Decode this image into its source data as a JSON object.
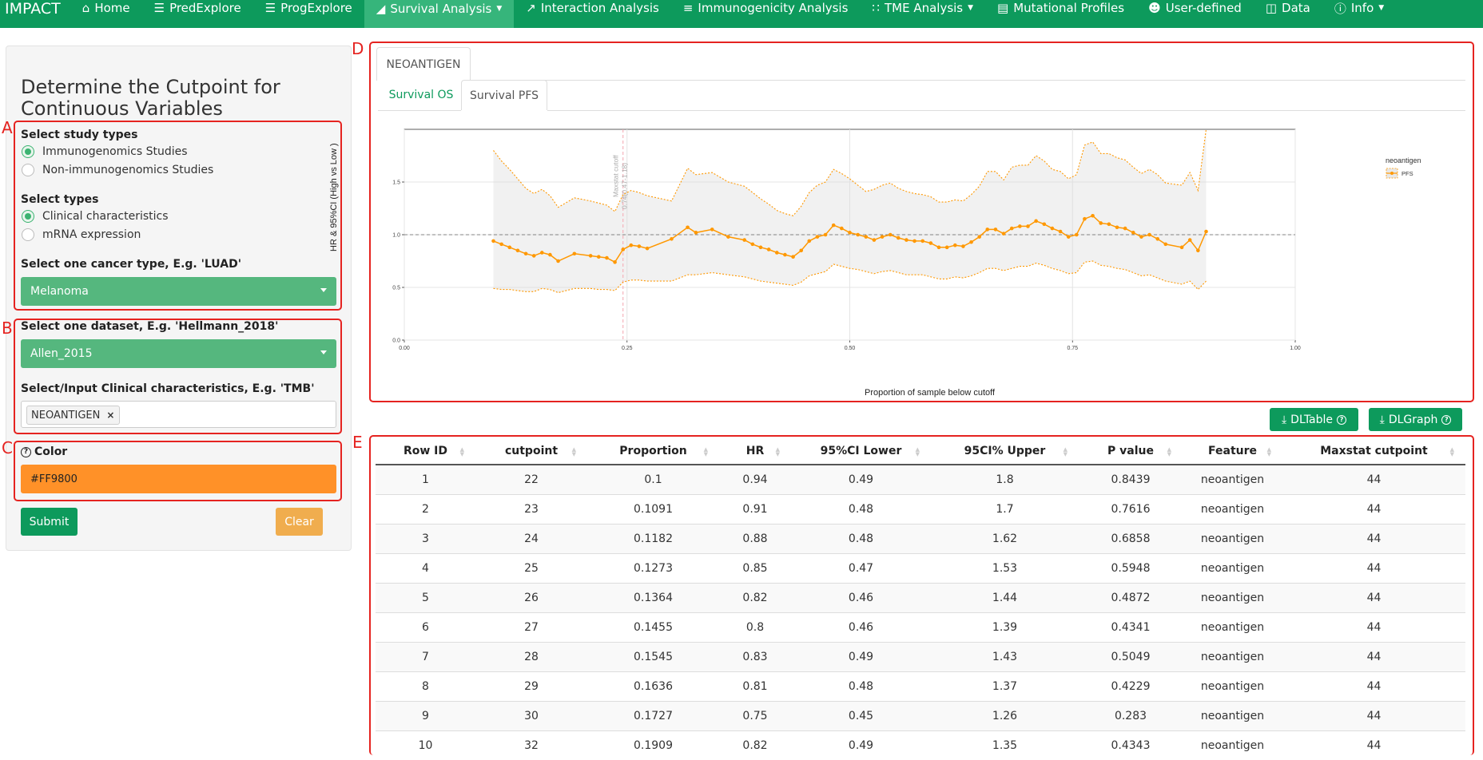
{
  "navbar": {
    "brand": "IMPACT",
    "items": [
      {
        "label": "Home",
        "icon": "home-icon"
      },
      {
        "label": "PredExplore",
        "icon": "list-icon"
      },
      {
        "label": "ProgExplore",
        "icon": "list-icon"
      },
      {
        "label": "Survival Analysis",
        "icon": "area-chart-icon",
        "active": true,
        "dropdown": true
      },
      {
        "label": "Interaction Analysis",
        "icon": "line-chart-icon"
      },
      {
        "label": "Immunogenicity Analysis",
        "icon": "sliders-icon"
      },
      {
        "label": "TME Analysis",
        "icon": "grid-icon",
        "dropdown": true
      },
      {
        "label": "Mutational Profiles",
        "icon": "list-alt-icon"
      },
      {
        "label": "User-defined",
        "icon": "user-icon"
      },
      {
        "label": "Data",
        "icon": "database-icon"
      },
      {
        "label": "Info",
        "icon": "info-icon",
        "dropdown": true
      }
    ]
  },
  "sidebar": {
    "title": "Determine the Cutpoint for Continuous Variables",
    "box_labels": [
      "A",
      "B",
      "C",
      "D",
      "E"
    ],
    "study_types": {
      "label": "Select study types",
      "options": [
        "Immunogenomics Studies",
        "Non-immunogenomics Studies"
      ],
      "selected": "Immunogenomics Studies"
    },
    "types": {
      "label": "Select types",
      "options": [
        "Clinical characteristics",
        "mRNA expression"
      ],
      "selected": "Clinical characteristics"
    },
    "cancer": {
      "label": "Select one cancer type, E.g. 'LUAD'",
      "value": "Melanoma"
    },
    "dataset": {
      "label": "Select one dataset, E.g. 'Hellmann_2018'",
      "value": "Allen_2015"
    },
    "clinical": {
      "label": "Select/Input Clinical characteristics, E.g. 'TMB'",
      "tag": "NEOANTIGEN",
      "tag_remove": "×"
    },
    "color": {
      "label": "Color",
      "value": "#FF9800"
    },
    "submit_label": "Submit",
    "clear_label": "Clear"
  },
  "main": {
    "tab": "NEOANTIGEN",
    "subtabs": [
      {
        "label": "Survival OS",
        "active": false
      },
      {
        "label": "Survival PFS",
        "active": true
      }
    ],
    "dl_table": "DLTable",
    "dl_graph": "DLGraph"
  },
  "chart_data": {
    "type": "line",
    "xlabel": "Proportion of sample below cutoff",
    "ylabel": "HR & 95%CI (High vs Low )",
    "xlim": [
      0,
      1
    ],
    "ylim": [
      0,
      2
    ],
    "xticks": [
      "0.00",
      "0.25",
      "0.50",
      "0.75",
      "1.00"
    ],
    "yticks": [
      "0.0",
      "0.5",
      "1.0",
      "1.5"
    ],
    "reference_line": 1.0,
    "cutoff_x": 0.2455,
    "cutoff_label": "Maxstat cutoff",
    "cutoff_sublabel": "0.74(0.47-1.18)",
    "legend_title": "neoantigen",
    "series": [
      {
        "name": "PFS",
        "color": "#FF9800",
        "x": [
          0.1,
          0.1091,
          0.1182,
          0.1273,
          0.1364,
          0.1455,
          0.1545,
          0.1636,
          0.1727,
          0.1909,
          0.2091,
          0.2182,
          0.2273,
          0.2364,
          0.2455,
          0.2545,
          0.2636,
          0.2727,
          0.3,
          0.318,
          0.3273,
          0.3455,
          0.3636,
          0.3818,
          0.3909,
          0.4,
          0.4091,
          0.4182,
          0.4273,
          0.4364,
          0.4455,
          0.4545,
          0.4636,
          0.4727,
          0.4818,
          0.4909,
          0.5,
          0.5091,
          0.5182,
          0.5273,
          0.5364,
          0.5455,
          0.5545,
          0.5636,
          0.5727,
          0.5818,
          0.5909,
          0.6,
          0.6091,
          0.6182,
          0.6273,
          0.6364,
          0.6455,
          0.6545,
          0.6636,
          0.6727,
          0.6818,
          0.6909,
          0.7,
          0.7091,
          0.7182,
          0.7273,
          0.7364,
          0.7455,
          0.7545,
          0.7636,
          0.7727,
          0.7818,
          0.7909,
          0.8,
          0.8091,
          0.8182,
          0.8273,
          0.8364,
          0.8455,
          0.8545,
          0.8727,
          0.8818,
          0.8909,
          0.9
        ],
        "hr": [
          0.94,
          0.91,
          0.88,
          0.85,
          0.82,
          0.8,
          0.83,
          0.81,
          0.75,
          0.82,
          0.8,
          0.79,
          0.78,
          0.74,
          0.86,
          0.9,
          0.89,
          0.87,
          0.96,
          1.07,
          1.02,
          1.05,
          0.98,
          0.95,
          0.91,
          0.88,
          0.86,
          0.83,
          0.81,
          0.79,
          0.85,
          0.94,
          0.98,
          1.0,
          1.09,
          1.06,
          1.02,
          1.0,
          0.98,
          0.95,
          0.98,
          1.0,
          0.97,
          0.95,
          0.94,
          0.94,
          0.92,
          0.88,
          0.88,
          0.9,
          0.89,
          0.93,
          0.98,
          1.05,
          1.05,
          1.01,
          1.06,
          1.08,
          1.08,
          1.13,
          1.1,
          1.06,
          1.03,
          0.98,
          1.0,
          1.15,
          1.18,
          1.11,
          1.1,
          1.07,
          1.06,
          1.02,
          0.98,
          1.0,
          0.96,
          0.91,
          0.88,
          0.95,
          0.85,
          1.03
        ],
        "lower": [
          0.49,
          0.48,
          0.48,
          0.47,
          0.46,
          0.46,
          0.49,
          0.48,
          0.45,
          0.49,
          0.49,
          0.48,
          0.48,
          0.47,
          0.55,
          0.57,
          0.57,
          0.56,
          0.56,
          0.62,
          0.62,
          0.64,
          0.62,
          0.6,
          0.58,
          0.56,
          0.55,
          0.54,
          0.53,
          0.52,
          0.55,
          0.61,
          0.63,
          0.65,
          0.72,
          0.7,
          0.68,
          0.67,
          0.65,
          0.63,
          0.65,
          0.66,
          0.64,
          0.62,
          0.62,
          0.62,
          0.6,
          0.58,
          0.58,
          0.6,
          0.59,
          0.61,
          0.64,
          0.68,
          0.68,
          0.66,
          0.68,
          0.7,
          0.7,
          0.73,
          0.71,
          0.68,
          0.66,
          0.63,
          0.64,
          0.74,
          0.75,
          0.71,
          0.7,
          0.68,
          0.67,
          0.64,
          0.61,
          0.62,
          0.59,
          0.56,
          0.53,
          0.56,
          0.48,
          0.56
        ],
        "upper": [
          1.8,
          1.7,
          1.62,
          1.53,
          1.44,
          1.39,
          1.43,
          1.37,
          1.26,
          1.35,
          1.32,
          1.3,
          1.28,
          1.22,
          1.38,
          1.42,
          1.4,
          1.37,
          1.32,
          1.63,
          1.57,
          1.59,
          1.5,
          1.46,
          1.4,
          1.34,
          1.29,
          1.23,
          1.2,
          1.18,
          1.27,
          1.4,
          1.47,
          1.5,
          1.62,
          1.58,
          1.53,
          1.47,
          1.41,
          1.43,
          1.47,
          1.49,
          1.44,
          1.41,
          1.39,
          1.38,
          1.36,
          1.31,
          1.31,
          1.33,
          1.32,
          1.38,
          1.46,
          1.6,
          1.6,
          1.52,
          1.64,
          1.66,
          1.66,
          1.75,
          1.7,
          1.62,
          1.6,
          1.53,
          1.57,
          1.85,
          1.88,
          1.77,
          1.77,
          1.73,
          1.71,
          1.64,
          1.58,
          1.62,
          1.57,
          1.49,
          1.47,
          1.59,
          1.42,
          2.0
        ]
      }
    ]
  },
  "table": {
    "columns": [
      "Row ID",
      "cutpoint",
      "Proportion",
      "HR",
      "95%CI Lower",
      "95CI% Upper",
      "P value",
      "Feature",
      "Maxstat cutpoint"
    ],
    "rows": [
      [
        "1",
        "22",
        "0.1",
        "0.94",
        "0.49",
        "1.8",
        "0.8439",
        "neoantigen",
        "44"
      ],
      [
        "2",
        "23",
        "0.1091",
        "0.91",
        "0.48",
        "1.7",
        "0.7616",
        "neoantigen",
        "44"
      ],
      [
        "3",
        "24",
        "0.1182",
        "0.88",
        "0.48",
        "1.62",
        "0.6858",
        "neoantigen",
        "44"
      ],
      [
        "4",
        "25",
        "0.1273",
        "0.85",
        "0.47",
        "1.53",
        "0.5948",
        "neoantigen",
        "44"
      ],
      [
        "5",
        "26",
        "0.1364",
        "0.82",
        "0.46",
        "1.44",
        "0.4872",
        "neoantigen",
        "44"
      ],
      [
        "6",
        "27",
        "0.1455",
        "0.8",
        "0.46",
        "1.39",
        "0.4341",
        "neoantigen",
        "44"
      ],
      [
        "7",
        "28",
        "0.1545",
        "0.83",
        "0.49",
        "1.43",
        "0.5049",
        "neoantigen",
        "44"
      ],
      [
        "8",
        "29",
        "0.1636",
        "0.81",
        "0.48",
        "1.37",
        "0.4229",
        "neoantigen",
        "44"
      ],
      [
        "9",
        "30",
        "0.1727",
        "0.75",
        "0.45",
        "1.26",
        "0.283",
        "neoantigen",
        "44"
      ],
      [
        "10",
        "32",
        "0.1909",
        "0.82",
        "0.49",
        "1.35",
        "0.4343",
        "neoantigen",
        "44"
      ]
    ]
  }
}
